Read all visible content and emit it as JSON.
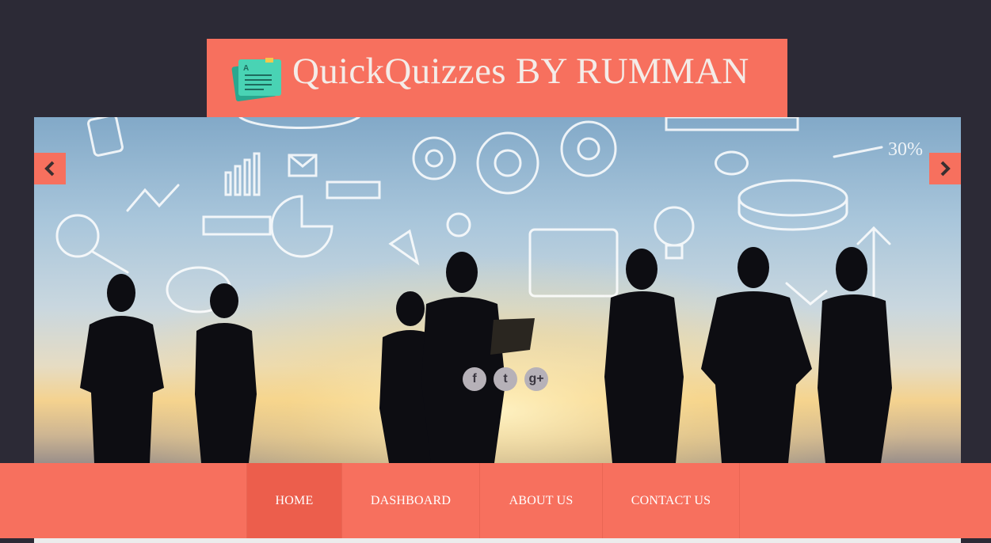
{
  "header": {
    "title": "QuickQuizzes BY RUMMAN",
    "logo_icon": "quiz-notes-icon"
  },
  "colors": {
    "accent": "#f7705e",
    "accent_active": "#ec5e4c",
    "background": "#2c2a36"
  },
  "slider": {
    "prev_icon": "chevron-left-icon",
    "next_icon": "chevron-right-icon"
  },
  "social": [
    {
      "name": "facebook-icon",
      "glyph": "f"
    },
    {
      "name": "twitter-icon",
      "glyph": "t"
    },
    {
      "name": "google-plus-icon",
      "glyph": "g+"
    }
  ],
  "nav": {
    "items": [
      {
        "label": "HOME",
        "active": true
      },
      {
        "label": "DASHBOARD",
        "active": false
      },
      {
        "label": "ABOUT US",
        "active": false
      },
      {
        "label": "CONTACT US",
        "active": false
      }
    ]
  }
}
